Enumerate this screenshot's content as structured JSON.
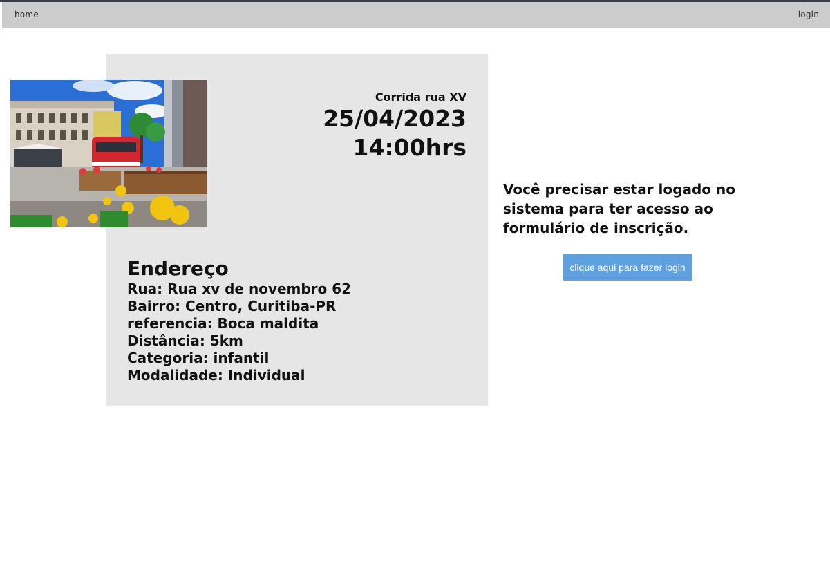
{
  "nav": {
    "home_label": "home",
    "login_label": "login"
  },
  "event": {
    "name": "Corrida rua XV",
    "date": "25/04/2023",
    "time": "14:00hrs"
  },
  "address": {
    "title": "Endereço",
    "lines": [
      "Rua: Rua xv de novembro 62",
      "Bairro: Centro, Curitiba-PR",
      "referencia: Boca maldita",
      "Distância: 5km",
      "Categoria: infantil",
      "Modalidade: Individual"
    ]
  },
  "login_prompt": {
    "message": "Você precisar estar logado no sistema para ter acesso ao formulário de inscrição.",
    "button_label": "clique aqui para fazer login"
  },
  "colors": {
    "navbar_bg": "#cccccc",
    "card_bg": "#e6e6e6",
    "button_bg": "#5fa0e0"
  },
  "icons": {
    "photo": "street-photo-rua-xv"
  }
}
